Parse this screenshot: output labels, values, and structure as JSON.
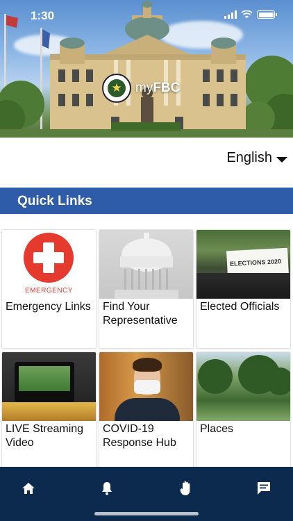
{
  "status_bar": {
    "time": "1:30"
  },
  "hero": {
    "brand_prefix": "my",
    "brand_bold": "FBC",
    "seal_glyph": "★"
  },
  "language": {
    "selected": "English"
  },
  "quick_links": {
    "title": "Quick Links",
    "tiles": [
      {
        "label": "Emergency Links",
        "image_caption": "EMERGENCY"
      },
      {
        "label": "Find Your Representative"
      },
      {
        "label": "Elected Officials",
        "image_caption": "ELECTIONS 2020"
      },
      {
        "label": "LIVE Streaming Video"
      },
      {
        "label": "COVID-19 Response Hub"
      },
      {
        "label": "Places"
      }
    ]
  },
  "nav": {
    "icons": [
      "home-icon",
      "bell-icon",
      "raised-hand-icon",
      "chat-icon"
    ]
  },
  "colors": {
    "section_bar": "#2e5ca8",
    "tab_bar": "#0c2a4d",
    "emergency_red": "#e53b2f"
  }
}
